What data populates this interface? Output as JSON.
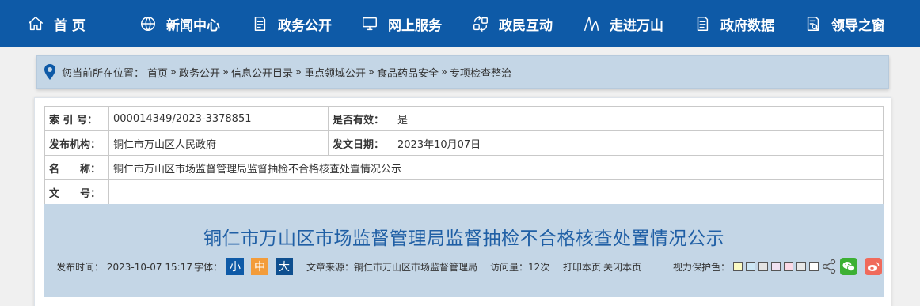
{
  "nav": {
    "items": [
      {
        "label": "首 页",
        "icon": "home-icon"
      },
      {
        "label": "新闻中心",
        "icon": "globe-icon"
      },
      {
        "label": "政务公开",
        "icon": "document-icon"
      },
      {
        "label": "网上服务",
        "icon": "monitor-icon"
      },
      {
        "label": "政民互动",
        "icon": "interaction-icon"
      },
      {
        "label": "走进万山",
        "icon": "landmark-icon"
      },
      {
        "label": "政府数据",
        "icon": "data-icon"
      },
      {
        "label": "领导之窗",
        "icon": "leader-icon"
      }
    ],
    "bg_color": "#0e5aa7"
  },
  "breadcrumb": {
    "prefix": "您当前所在位置：",
    "items": [
      "首页",
      "政务公开",
      "信息公开目录",
      "重点领域公开",
      "食品药品安全",
      "专项检查整治"
    ],
    "separator": "»",
    "icon": "location-pin-icon"
  },
  "meta": {
    "index_label": "索 引 号：",
    "index_value": "000014349/2023-3378851",
    "valid_label": "是否有效：",
    "valid_value": "是",
    "org_label": "发布机构：",
    "org_value": "铜仁市万山区人民政府",
    "date_label": "发文日期：",
    "date_value": "2023年10月07日",
    "name_label": "名　　称：",
    "name_value": "铜仁市万山区市场监督管理局监督抽检不合格核查处置情况公示",
    "docno_label": "文　　号：",
    "docno_value": ""
  },
  "article": {
    "title": "铜仁市万山区市场监督管理局监督抽检不合格核查处置情况公示",
    "publish_time": "发布时间： 2023-10-07 15:17",
    "font_label": "字体：",
    "font_sizes": [
      {
        "label": "小",
        "color": "#0e5aa7"
      },
      {
        "label": "中",
        "color": "#f39c3a"
      },
      {
        "label": "大",
        "color": "#0e4f8f"
      }
    ],
    "source": "文章来源：铜仁市万山区市场监督管理局",
    "visits": "访问量：12次",
    "print": "打印本页",
    "close": "关闭本页",
    "eye_label": "视力保护色：",
    "eye_colors": [
      "#fafac3",
      "#cde7f5",
      "#e3e3e3",
      "#f0e2f2",
      "#fbd9e6",
      "#e8e8e8",
      "#ffffff"
    ],
    "social": [
      {
        "name": "wechat-icon",
        "color": "#3cb034"
      },
      {
        "name": "weibo-icon",
        "color": "#f06a5b"
      }
    ]
  }
}
